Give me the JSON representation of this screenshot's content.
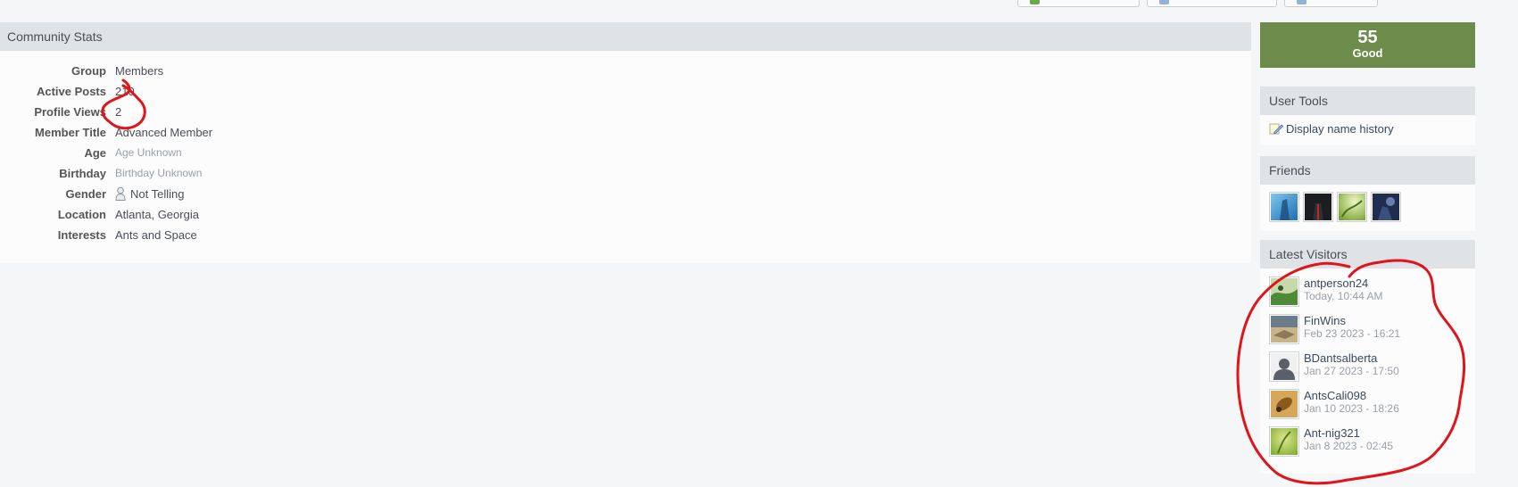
{
  "stats": {
    "header": "Community Stats",
    "rows": [
      {
        "label": "Group",
        "value": "Members",
        "muted": false
      },
      {
        "label": "Active Posts",
        "value": "210",
        "muted": false
      },
      {
        "label": "Profile Views",
        "value": "2",
        "muted": false
      },
      {
        "label": "Member Title",
        "value": "Advanced Member",
        "muted": false
      },
      {
        "label": "Age",
        "value": "Age Unknown",
        "muted": true
      },
      {
        "label": "Birthday",
        "value": "Birthday Unknown",
        "muted": true
      },
      {
        "label": "Gender",
        "value": "Not Telling",
        "muted": false,
        "icon": "gender-neutral-icon"
      },
      {
        "label": "Location",
        "value": "Atlanta, Georgia",
        "muted": false
      },
      {
        "label": "Interests",
        "value": "Ants and Space",
        "muted": false
      }
    ]
  },
  "reputation": {
    "number": "55",
    "label": "Good",
    "color": "#6d8b4b"
  },
  "user_tools": {
    "header": "User Tools",
    "links": [
      {
        "label": "Display name history",
        "icon": "pencil-icon"
      }
    ]
  },
  "friends": {
    "header": "Friends",
    "items": [
      {
        "name": "friend-1",
        "colors": [
          "#1f6fb0",
          "#7ec7f0"
        ]
      },
      {
        "name": "friend-2",
        "colors": [
          "#1b1d20",
          "#c0262b"
        ]
      },
      {
        "name": "friend-3",
        "colors": [
          "#7aa536",
          "#d9eaa0"
        ]
      },
      {
        "name": "friend-4",
        "colors": [
          "#1f2d4f",
          "#8aa3d8"
        ]
      }
    ]
  },
  "visitors": {
    "header": "Latest Visitors",
    "items": [
      {
        "name": "antperson24",
        "date": "Today, 10:44 AM",
        "colors": [
          "#4f8a3a",
          "#c7d9a8"
        ]
      },
      {
        "name": "FinWins",
        "date": "Feb 23 2023 - 16:21",
        "colors": [
          "#6b7d8a",
          "#c9b48a"
        ]
      },
      {
        "name": "BDantsalberta",
        "date": "Jan 27 2023 - 17:50",
        "colors": [
          "#eef0f2",
          "#5a6069"
        ],
        "default": true
      },
      {
        "name": "AntsCali098",
        "date": "Jan 10 2023 - 18:26",
        "colors": [
          "#8a5a1c",
          "#d6a75a"
        ]
      },
      {
        "name": "Ant-nig321",
        "date": "Jan 8 2023 - 02:45",
        "colors": [
          "#7ca62e",
          "#dbe98e"
        ]
      }
    ]
  },
  "colors": {
    "annotation": "#e0141c",
    "header_bg": "#dfe3e6"
  }
}
